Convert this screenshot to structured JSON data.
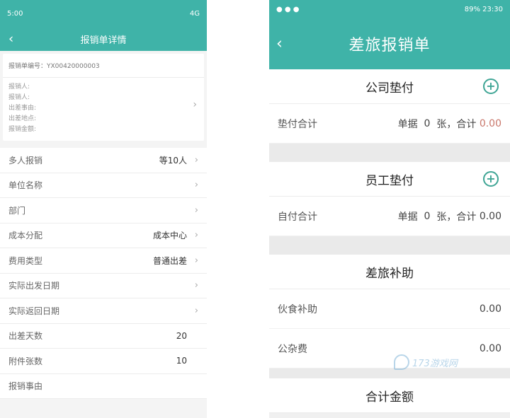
{
  "left": {
    "status": {
      "time": "5:00",
      "right": "4G"
    },
    "nav": {
      "title": "报销单详情",
      "back": "‹"
    },
    "card": {
      "order": "报销单编号：YX00420000003",
      "fields": [
        "报销人:",
        "报销人:",
        "出差事由:",
        "出差地点:",
        "报销金额:"
      ],
      "chevron": "›"
    },
    "rows": [
      {
        "label": "多人报销",
        "value": "等10人",
        "chevron": "›"
      },
      {
        "label": "单位名称",
        "value": "",
        "chevron": "›"
      },
      {
        "label": "部门",
        "value": "",
        "chevron": "›"
      },
      {
        "label": "成本分配",
        "value": "成本中心",
        "chevron": "›"
      },
      {
        "label": "费用类型",
        "value": "普通出差",
        "chevron": "›"
      },
      {
        "label": "实际出发日期",
        "value": "",
        "chevron": "›"
      },
      {
        "label": "实际返回日期",
        "value": "",
        "chevron": "›"
      },
      {
        "label": "出差天数",
        "value": "20",
        "chevron": ""
      },
      {
        "label": "附件张数",
        "value": "10",
        "chevron": ""
      },
      {
        "label": "报销事由",
        "value": "",
        "chevron": ""
      }
    ]
  },
  "right": {
    "status": {
      "right": "89% 23:30"
    },
    "nav": {
      "title": "差旅报销单",
      "back": "‹"
    },
    "company": {
      "title": "公司垫付",
      "plus": "+",
      "row": {
        "label": "垫付合计",
        "prefix": "单据",
        "count": "0",
        "mid": "张，合计",
        "amount": "0.00"
      }
    },
    "employee": {
      "title": "员工垫付",
      "plus": "+",
      "row": {
        "label": "自付合计",
        "prefix": "单据",
        "count": "0",
        "mid": "张，合计",
        "amount": "0.00"
      }
    },
    "subsidy": {
      "title": "差旅补助",
      "rows": [
        {
          "label": "伙食补助",
          "value": "0.00"
        },
        {
          "label": "公杂费",
          "value": "0.00"
        }
      ]
    },
    "total": {
      "title": "合计金额"
    }
  },
  "watermark": {
    "text": "173游戏网"
  },
  "colors": {
    "accent": "#3fb3a8",
    "plus": "#3fa595",
    "amount_red": "#c9776b"
  }
}
